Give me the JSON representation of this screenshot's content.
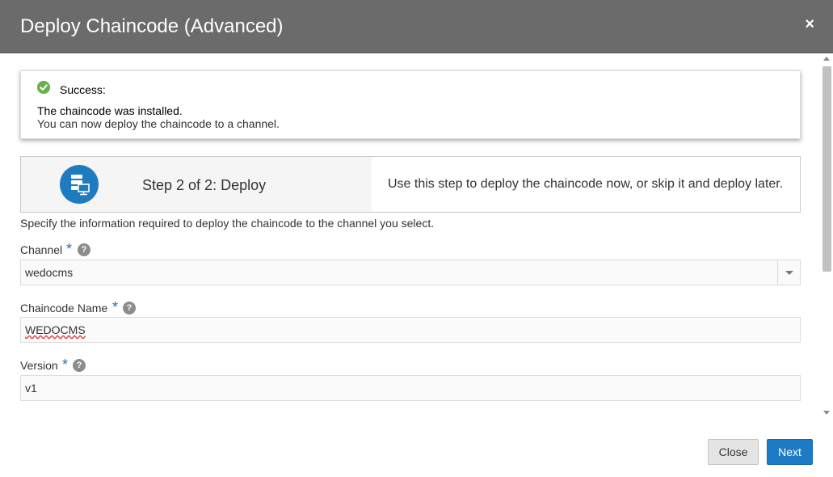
{
  "dialog": {
    "title": "Deploy Chaincode (Advanced)",
    "close_glyph": "×"
  },
  "success": {
    "label": "Success:",
    "line1": "The chaincode was installed.",
    "line2": "You can now deploy the chaincode to a channel.",
    "icon": "check-circle-icon",
    "color": "#6ab04c"
  },
  "step": {
    "title": "Step 2 of 2: Deploy",
    "description": "Use this step to deploy the chaincode now, or skip it and deploy later.",
    "icon": "deploy-network-icon",
    "icon_color": "#1f7bc0"
  },
  "intro": "Specify the information required to deploy the chaincode to the channel you select.",
  "fields": {
    "channel": {
      "label": "Channel",
      "required": "*",
      "value": "wedocms"
    },
    "chaincode_name": {
      "label": "Chaincode Name",
      "required": "*",
      "value": "WEDOCMS"
    },
    "version": {
      "label": "Version",
      "required": "*",
      "value": "v1"
    }
  },
  "help_glyph": "?",
  "buttons": {
    "close": "Close",
    "next": "Next"
  },
  "colors": {
    "header_bg": "#6b6b6b",
    "primary": "#1d7bc6",
    "required": "#1f6fb5"
  }
}
